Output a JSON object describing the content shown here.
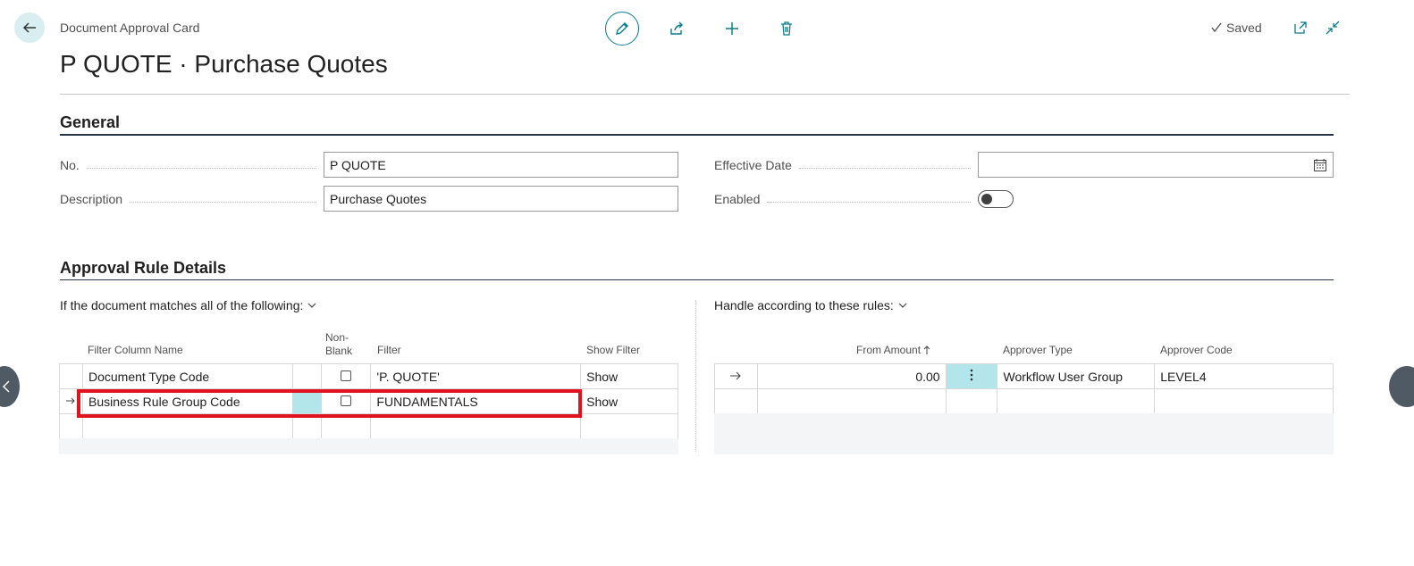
{
  "header": {
    "caption": "Document Approval Card",
    "title": "P QUOTE · Purchase Quotes",
    "saved_label": "Saved"
  },
  "general": {
    "title": "General",
    "no_label": "No.",
    "no_value": "P QUOTE",
    "description_label": "Description",
    "description_value": "Purchase Quotes",
    "effective_date_label": "Effective Date",
    "effective_date_value": "",
    "enabled_label": "Enabled",
    "enabled": false
  },
  "approval_rules": {
    "title": "Approval Rule Details",
    "conditions_caption": "If the document matches all of the following:",
    "handle_caption": "Handle according to these rules:",
    "filter_columns": {
      "filter_column_name": "Filter Column Name",
      "non_blank_line1": "Non-",
      "non_blank_line2": "Blank",
      "filter": "Filter",
      "show_filter": "Show Filter"
    },
    "filter_rows": [
      {
        "name": "Document Type Code",
        "non_blank": false,
        "filter": "'P. QUOTE'",
        "show": "Show"
      },
      {
        "name": "Business Rule Group Code",
        "non_blank": false,
        "filter": "FUNDAMENTALS",
        "show": "Show"
      }
    ],
    "rule_columns": {
      "from_amount": "From Amount",
      "approver_type": "Approver Type",
      "approver_code": "Approver Code"
    },
    "rule_rows": [
      {
        "from_amount": "0.00",
        "approver_type": "Workflow User Group",
        "approver_code": "LEVEL4"
      }
    ]
  },
  "icons": [
    "back-arrow-icon",
    "pencil-icon",
    "share-icon",
    "plus-icon",
    "trash-icon",
    "check-icon",
    "open-new-window-icon",
    "collapse-icon",
    "calendar-icon",
    "chevron-down-icon",
    "row-arrow-icon",
    "ellipsis-vertical-icon",
    "sort-up-icon"
  ],
  "colors": {
    "accent": "#0a7d8c",
    "highlight": "#e0141e",
    "selected_cell": "#b3e6ea"
  }
}
